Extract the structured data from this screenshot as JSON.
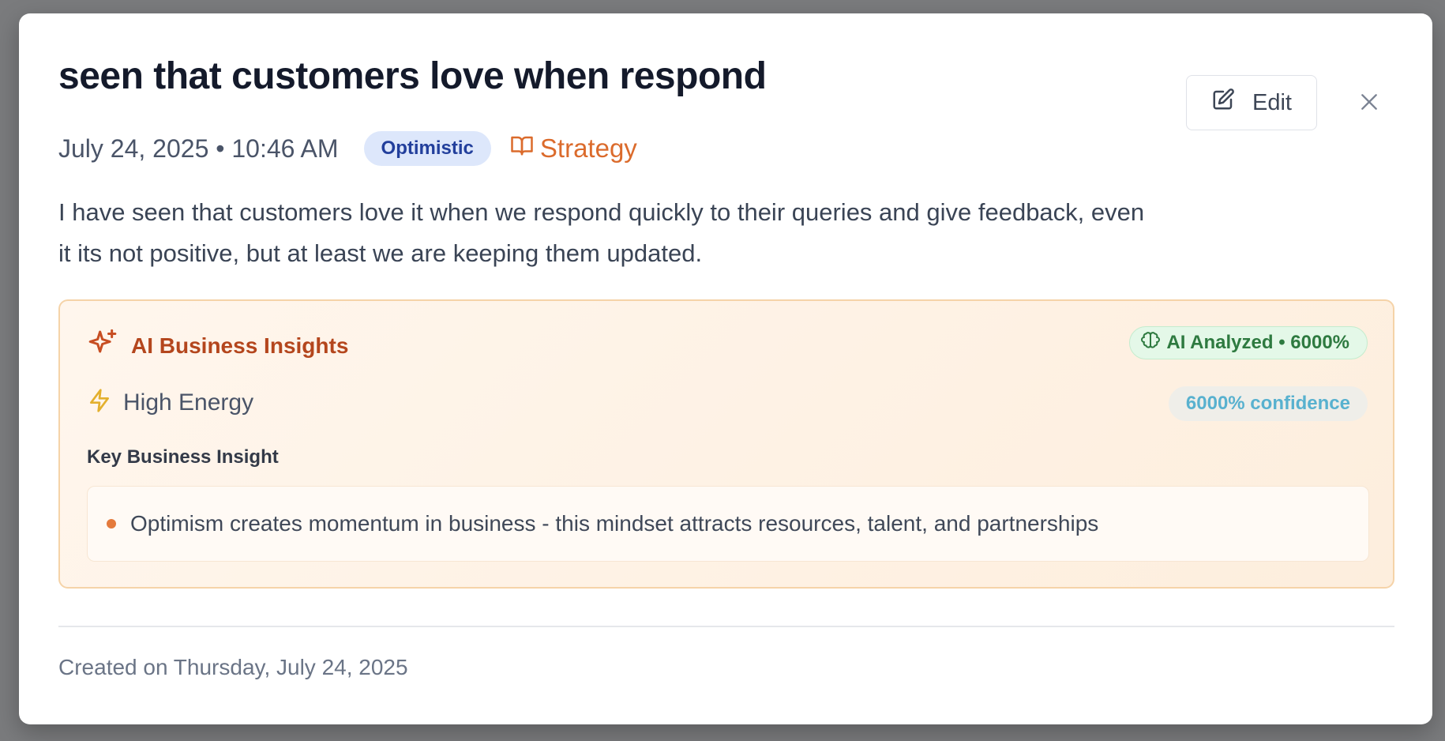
{
  "entry": {
    "title": "seen that customers love when respond",
    "datetime": "July 24, 2025 • 10:46 AM",
    "mood": "Optimistic",
    "category": "Strategy",
    "category_icon": "book-open-icon",
    "description": "I have seen that customers love it when we respond quickly to their queries and give feedback, even it its not positive, but at least we are keeping them updated."
  },
  "actions": {
    "edit_label": "Edit",
    "edit_icon": "pencil-square-icon",
    "close_icon": "close-icon"
  },
  "insights": {
    "title": "AI Business Insights",
    "title_icon": "sparkles-icon",
    "ai_badge": "AI Analyzed • 6000%",
    "ai_badge_icon": "brain-icon",
    "energy_label": "High Energy",
    "energy_icon": "lightning-icon",
    "confidence": "6000% confidence",
    "key_insight_heading": "Key Business Insight",
    "key_insights": [
      "Optimism creates momentum in business - this mindset attracts resources, talent, and partnerships"
    ]
  },
  "footer": {
    "created_text": "Created on Thursday, July 24, 2025"
  },
  "colors": {
    "accent_orange": "#db6b2c",
    "insight_title": "#b4461d",
    "mood_badge_bg": "#dde7fb",
    "mood_badge_text": "#223f9c",
    "ai_badge_text": "#2e7a40",
    "confidence_text": "#58b1cf"
  }
}
